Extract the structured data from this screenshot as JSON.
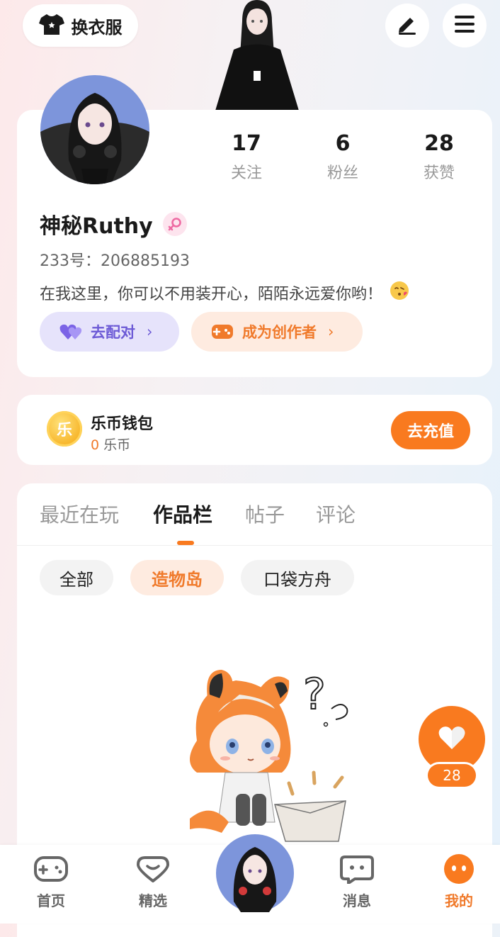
{
  "topbar": {
    "outfit_label": "换衣服"
  },
  "profile": {
    "stats": [
      {
        "num": "17",
        "label": "关注"
      },
      {
        "num": "6",
        "label": "粉丝"
      },
      {
        "num": "28",
        "label": "获赞"
      }
    ],
    "name": "神秘Ruthy",
    "uid": "233号：206885193",
    "bio": "在我这里，你可以不用装开心，陌陌永远爱你哟！",
    "match_label": "去配对",
    "creator_label": "成为创作者"
  },
  "wallet": {
    "title": "乐币钱包",
    "coin_glyph": "乐",
    "amount": "0",
    "unit": "乐币",
    "recharge_label": "去充值"
  },
  "works": {
    "tabs": [
      "最近在玩",
      "作品栏",
      "帖子",
      "评论"
    ],
    "active_tab": 1,
    "chips": [
      "全部",
      "造物岛",
      "口袋方舟"
    ],
    "active_chip": 1
  },
  "like": {
    "count": "28"
  },
  "bottom_nav": {
    "items": [
      "首页",
      "精选",
      "消息",
      "我的"
    ],
    "active": 3
  },
  "colors": {
    "accent": "#f97a1f",
    "purple": "#6d5bd6"
  }
}
